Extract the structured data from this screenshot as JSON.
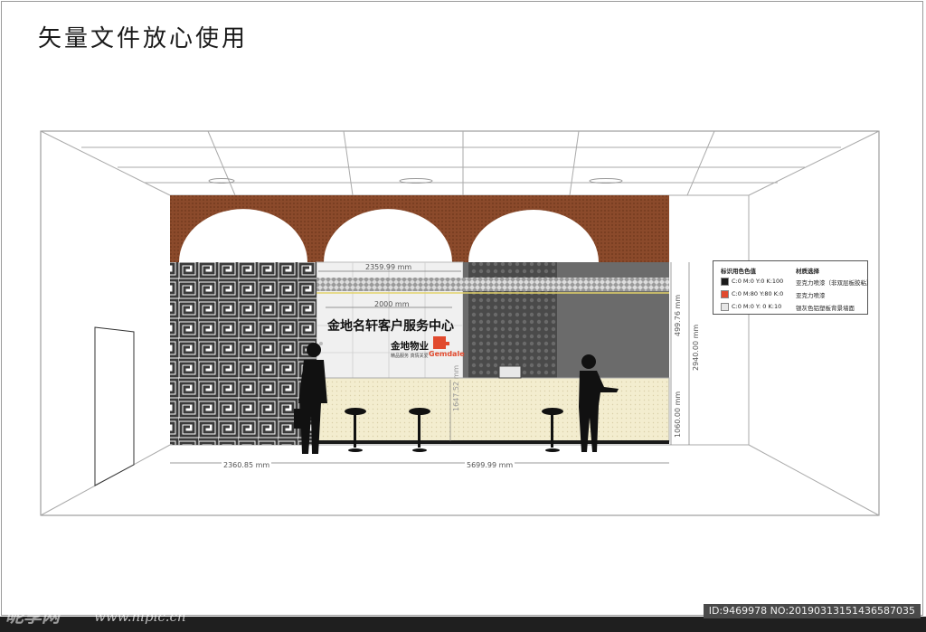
{
  "title": "矢量文件放心使用",
  "sign": {
    "main": "金地名轩客户服务中心",
    "brand": "金地物业",
    "brand_en": "Gemdale",
    "slogan": "精品服务  真情关爱",
    "width_label": "2000 mm"
  },
  "dimensions": {
    "top_width": "2359.99 mm",
    "left_width": "2360.85 mm",
    "counter_width": "5699.99 mm",
    "upper_height": "499.76 mm",
    "total_height": "2940.00 mm",
    "counter_height": "1060.00 mm",
    "counter_depth": "1647.52 mm"
  },
  "legend": {
    "header_color": "标识用色色值",
    "header_material": "材质选择",
    "rows": [
      {
        "color": "#1a1a1a",
        "value": "C:0  M:0  Y:0  K:100",
        "material": "亚克力喷漆（非双层板胶粘）"
      },
      {
        "color": "#e14a2e",
        "value": "C:0  M:80  Y:80  K:0",
        "material": "亚克力喷漆"
      },
      {
        "color": "#e6e6e6",
        "value": "C:0  M:0   Y: 0   K:10",
        "material": "银灰色铝塑板背景墙面"
      }
    ]
  },
  "watermark": {
    "logo": "昵享网",
    "url": "www.nipic.cn",
    "id": "ID:9469978 NO:20190313151436587035"
  },
  "colors": {
    "brick": "#8b4a2b",
    "lattice_dark": "#3a3a3a",
    "counter": "#f3edcf",
    "panel": "#6b6b6b",
    "accent": "#e14a2e"
  }
}
